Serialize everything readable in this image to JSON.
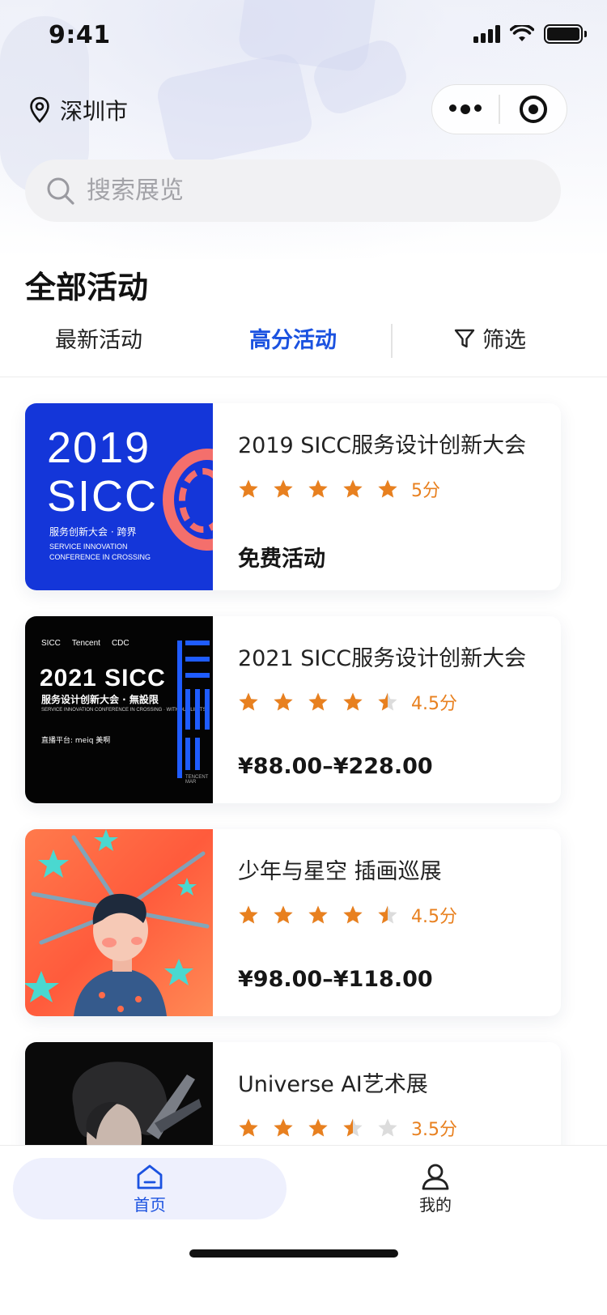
{
  "status_bar": {
    "time": "9:41"
  },
  "header": {
    "city": "深圳市",
    "capsule_more_icon": "more-dots-icon",
    "capsule_close_icon": "target-icon"
  },
  "search": {
    "placeholder": "搜索展览"
  },
  "page_title": "全部活动",
  "tabs": {
    "latest": "最新活动",
    "top_rated": "高分活动",
    "filter": "筛选",
    "active": "top_rated"
  },
  "activities": [
    {
      "title": "2019 SICC服务设计创新大会",
      "rating": 5,
      "score_label": "5分",
      "price": "免费活动",
      "thumb": {
        "year": "2019",
        "name": "SICC",
        "subtitle": "服务创新大会 · 跨界",
        "en_line1": "SERVICE INNOVATION",
        "en_line2": "CONFERENCE IN CROSSING"
      }
    },
    {
      "title": "2021 SICC服务设计创新大会",
      "rating": 4.5,
      "score_label": "4.5分",
      "price": "¥88.00–¥228.00",
      "thumb": {
        "logo1": "SICC",
        "logo2": "Tencent",
        "logo3": "CDC",
        "title": "2021 SICC",
        "subtitle": "服务设计创新大会 · 無設限",
        "en": "SERVICE INNOVATION CONFERENCE IN CROSSING · WITHOUT LIMITS",
        "live": "直播平台: meiq 美啊",
        "tag": "TENCENT MAR"
      }
    },
    {
      "title": "少年与星空 插画巡展",
      "rating": 4.5,
      "score_label": "4.5分",
      "price": "¥98.00–¥118.00"
    },
    {
      "title": "Universe AI艺术展",
      "rating": 3.5,
      "score_label": "3.5分",
      "price": ""
    }
  ],
  "bottom_nav": {
    "home": "首页",
    "me": "我的",
    "active": "home"
  },
  "colors": {
    "accent": "#1b52e0",
    "star": "#e8801f",
    "star_empty": "#dcdcdc"
  }
}
